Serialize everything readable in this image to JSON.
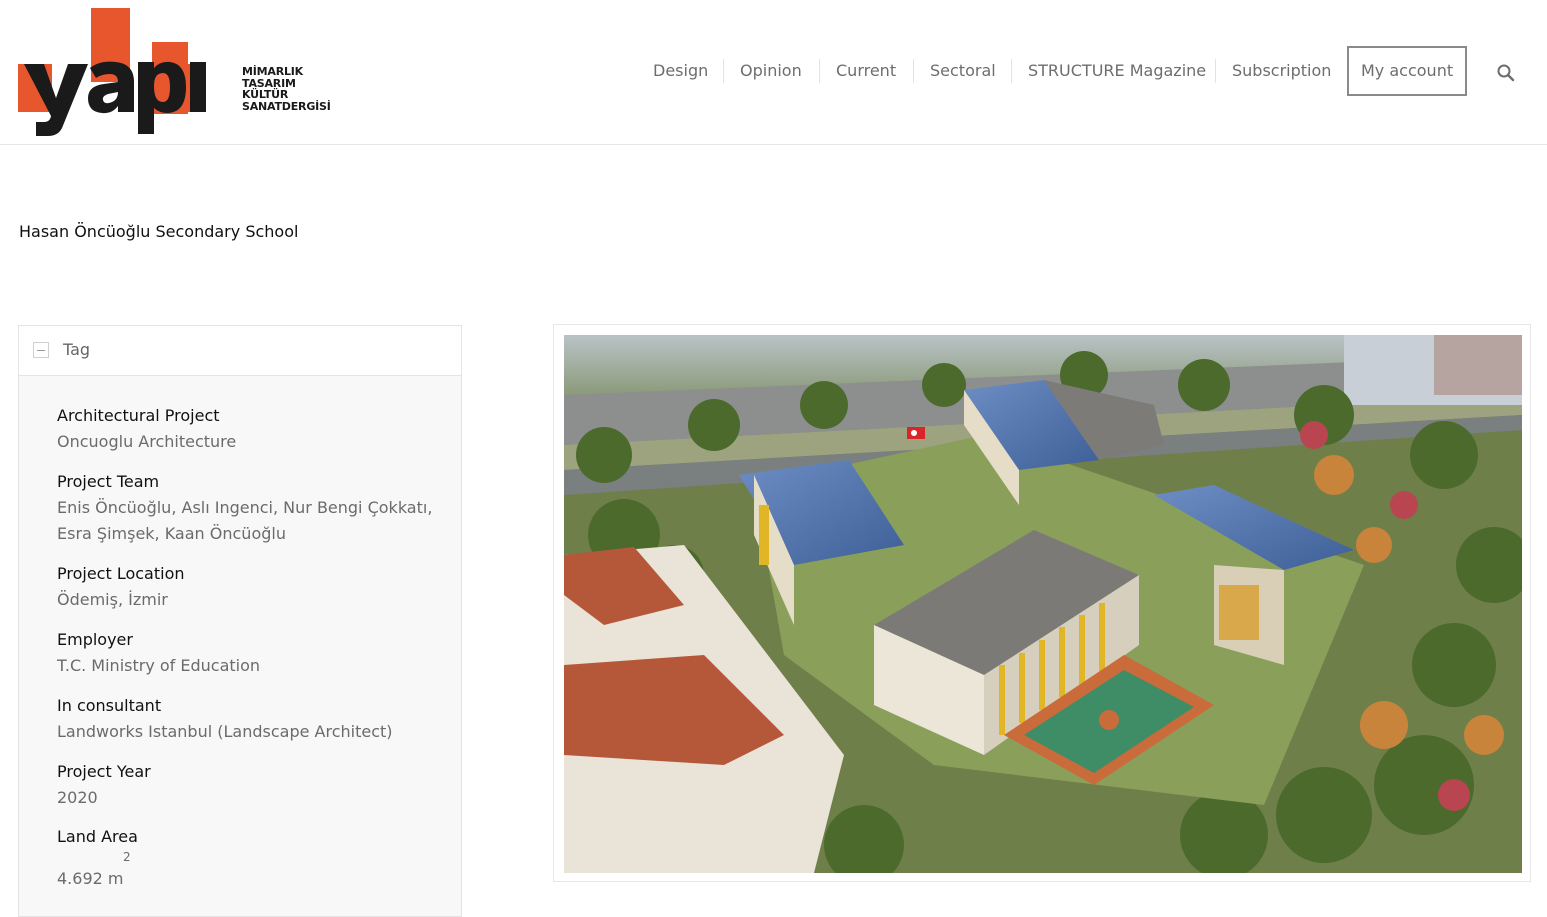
{
  "brand": {
    "logo_letters": "yapı",
    "tagline_lines": [
      "MİMARLIK",
      "TASARIM",
      "KÜLTÜR",
      "SANATDERGİSİ"
    ],
    "accent_color": "#e8562e",
    "text_color": "#1a1a1a"
  },
  "nav": {
    "items": [
      "Design",
      "Opinion",
      "Current",
      "Sectoral",
      "STRUCTURE Magazine",
      "Subscription"
    ],
    "account_label": "My account",
    "search_icon": "search-icon"
  },
  "page": {
    "title": "Hasan Öncüoğlu Secondary School"
  },
  "tag_panel": {
    "title": "Tag",
    "toggle_icon": "collapse-icon",
    "fields": [
      {
        "label": "Architectural Project",
        "value": "Oncuoglu Architecture"
      },
      {
        "label": "Project Team",
        "value_lines": [
          "Enis Öncüoğlu, Aslı Ingenci, Nur Bengi Çokkatı,",
          "Esra Şimşek, Kaan Öncüoğlu"
        ]
      },
      {
        "label": "Project Location",
        "value": "Ödemiş, İzmir"
      },
      {
        "label": "Employer",
        "value": "T.C. Ministry of Education"
      },
      {
        "label": "In consultant",
        "value": "Landworks Istanbul (Landscape Architect)"
      },
      {
        "label": "Project Year",
        "value": "2020"
      },
      {
        "label": "Land Area",
        "value": "4.692 m",
        "superscript": "2"
      }
    ]
  },
  "image": {
    "subject": "aerial-school-render"
  }
}
